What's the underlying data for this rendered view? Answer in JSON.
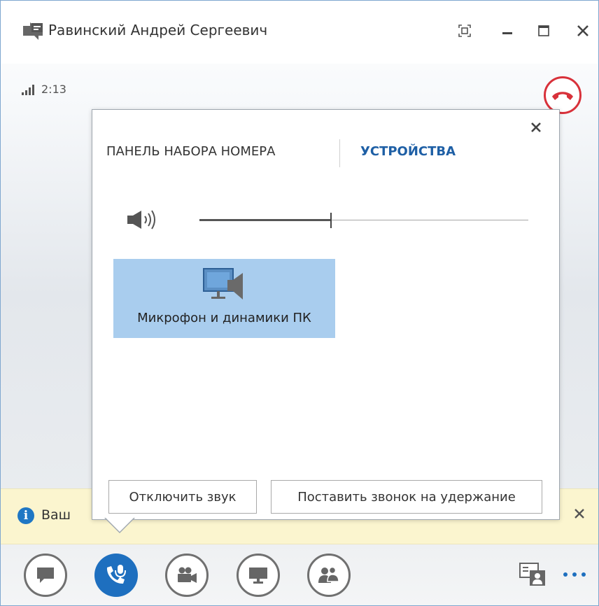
{
  "window": {
    "title": "Равинский Андрей Сергеевич"
  },
  "call": {
    "duration": "2:13",
    "signal_bars": 4
  },
  "devices_popup": {
    "tabs": [
      "ПАНЕЛЬ НАБОРА НОМЕРА",
      "УСТРОЙСТВА"
    ],
    "active_tab": "УСТРОЙСТВА",
    "volume_fraction": 0.4,
    "device_label": "Микрофон и динамики ПК",
    "mute_button": "Отключить звук",
    "hold_button": "Поставить звонок на удержание"
  },
  "infobar": {
    "text": "Ваш"
  },
  "toolbar": {
    "buttons": [
      {
        "name": "im-button",
        "icon": "speech-bubble-icon",
        "active": false
      },
      {
        "name": "call-controls-button",
        "icon": "phone-mic-icon",
        "active": true
      },
      {
        "name": "video-button",
        "icon": "video-camera-icon",
        "active": false
      },
      {
        "name": "present-button",
        "icon": "monitor-icon",
        "active": false
      },
      {
        "name": "participants-button",
        "icon": "people-icon",
        "active": false
      }
    ]
  },
  "colors": {
    "accent_blue": "#1e6fbf",
    "active_tab": "#1e5fa5",
    "hangup_red": "#d8313a",
    "device_selected": "#a9cdee",
    "infobar_bg": "#fbf5cf"
  }
}
